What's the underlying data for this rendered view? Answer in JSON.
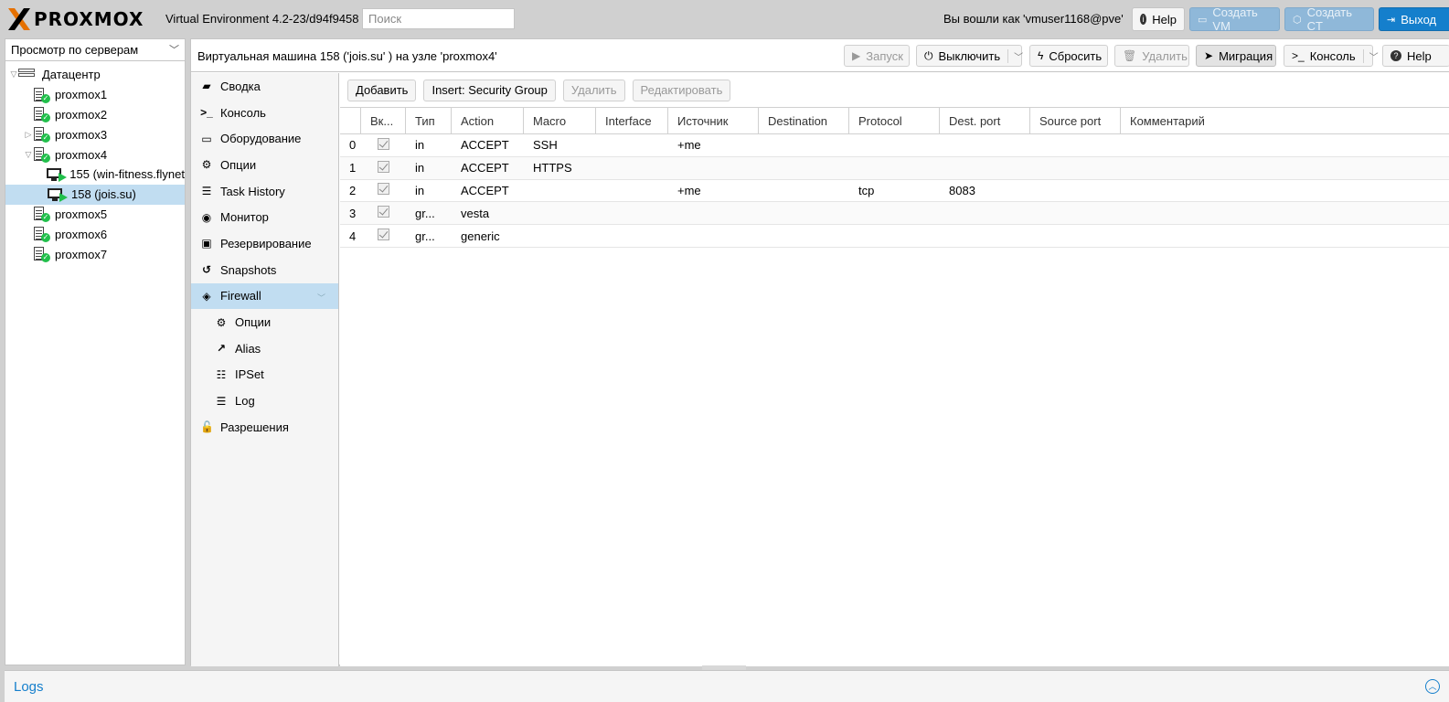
{
  "header": {
    "logo_text": "PROXMOX",
    "version": "Virtual Environment 4.2-23/d94f9458",
    "search_placeholder": "Поиск",
    "logged_in": "Вы вошли как 'vmuser1168@pve'",
    "help_label": "Help",
    "create_vm_label": "Создать VM",
    "create_ct_label": "Создать CT",
    "logout_label": "Выход"
  },
  "tree": {
    "view_select": "Просмотр по серверам",
    "items": [
      {
        "label": "Датацентр",
        "type": "datacenter",
        "level": 0,
        "expander": "▽"
      },
      {
        "label": "proxmox1",
        "type": "node",
        "level": 1,
        "expander": ""
      },
      {
        "label": "proxmox2",
        "type": "node",
        "level": 1,
        "expander": ""
      },
      {
        "label": "proxmox3",
        "type": "node",
        "level": 1,
        "expander": "▷"
      },
      {
        "label": "proxmox4",
        "type": "node",
        "level": 1,
        "expander": "▽"
      },
      {
        "label": "155 (win-fitness.flynet",
        "type": "vm",
        "level": 2,
        "expander": ""
      },
      {
        "label": "158 (jois.su)",
        "type": "vm",
        "level": 2,
        "expander": "",
        "selected": true
      },
      {
        "label": "proxmox5",
        "type": "node",
        "level": 1,
        "expander": ""
      },
      {
        "label": "proxmox6",
        "type": "node",
        "level": 1,
        "expander": ""
      },
      {
        "label": "proxmox7",
        "type": "node",
        "level": 1,
        "expander": ""
      }
    ]
  },
  "content": {
    "title": "Виртуальная машина 158 ('jois.su' ) на узле 'proxmox4'",
    "toolbar": {
      "start": "Запуск",
      "shutdown": "Выключить",
      "reset": "Сбросить",
      "remove": "Удалить",
      "migrate": "Миграция",
      "console": "Консоль",
      "help": "Help"
    }
  },
  "nav": {
    "items": [
      {
        "label": "Сводка",
        "icon": "book-icon",
        "glyph": "▰",
        "sub": false
      },
      {
        "label": "Консоль",
        "icon": "terminal-icon",
        "glyph": ">_",
        "sub": false
      },
      {
        "label": "Оборудование",
        "icon": "desktop-icon",
        "glyph": "▭",
        "sub": false
      },
      {
        "label": "Опции",
        "icon": "gear-icon",
        "glyph": "⚙",
        "sub": false
      },
      {
        "label": "Task History",
        "icon": "list-icon",
        "glyph": "☰",
        "sub": false
      },
      {
        "label": "Монитор",
        "icon": "eye-icon",
        "glyph": "◉",
        "sub": false
      },
      {
        "label": "Резервирование",
        "icon": "floppy-icon",
        "glyph": "▣",
        "sub": false
      },
      {
        "label": "Snapshots",
        "icon": "history-icon",
        "glyph": "↺",
        "sub": false
      },
      {
        "label": "Firewall",
        "icon": "shield-icon",
        "glyph": "◈",
        "sub": false,
        "selected": true
      },
      {
        "label": "Опции",
        "icon": "gear-icon",
        "glyph": "⚙",
        "sub": true
      },
      {
        "label": "Alias",
        "icon": "external-link-icon",
        "glyph": "↗",
        "sub": true
      },
      {
        "label": "IPSet",
        "icon": "list-ol-icon",
        "glyph": "☷",
        "sub": true
      },
      {
        "label": "Log",
        "icon": "list-icon",
        "glyph": "☰",
        "sub": true
      },
      {
        "label": "Разрешения",
        "icon": "unlock-icon",
        "glyph": "🔓",
        "sub": false
      }
    ]
  },
  "grid": {
    "toolbar": {
      "add": "Добавить",
      "insert_group": "Insert: Security Group",
      "remove": "Удалить",
      "edit": "Редактировать"
    },
    "columns": [
      "",
      "Вк...",
      "Тип",
      "Action",
      "Macro",
      "Interface",
      "Источник",
      "Destination",
      "Protocol",
      "Dest. port",
      "Source port",
      "Комментарий"
    ],
    "rows": [
      {
        "n": "0",
        "enabled": true,
        "type": "in",
        "action": "ACCEPT",
        "macro": "SSH",
        "iface": "",
        "source": "+me",
        "dest": "",
        "proto": "",
        "dport": "",
        "sport": "",
        "comment": ""
      },
      {
        "n": "1",
        "enabled": true,
        "type": "in",
        "action": "ACCEPT",
        "macro": "HTTPS",
        "iface": "",
        "source": "",
        "dest": "",
        "proto": "",
        "dport": "",
        "sport": "",
        "comment": ""
      },
      {
        "n": "2",
        "enabled": true,
        "type": "in",
        "action": "ACCEPT",
        "macro": "",
        "iface": "",
        "source": "+me",
        "dest": "",
        "proto": "tcp",
        "dport": "8083",
        "sport": "",
        "comment": ""
      },
      {
        "n": "3",
        "enabled": true,
        "type": "gr...",
        "action": "vesta",
        "macro": "",
        "iface": "",
        "source": "",
        "dest": "",
        "proto": "",
        "dport": "",
        "sport": "",
        "comment": ""
      },
      {
        "n": "4",
        "enabled": true,
        "type": "gr...",
        "action": "generic",
        "macro": "",
        "iface": "",
        "source": "",
        "dest": "",
        "proto": "",
        "dport": "",
        "sport": "",
        "comment": ""
      }
    ]
  },
  "logs": {
    "title": "Logs"
  },
  "colors": {
    "accent": "#157fcc",
    "selected": "#c1ddf1",
    "logo_orange": "#e57000",
    "status_ok": "#21bf4b"
  }
}
